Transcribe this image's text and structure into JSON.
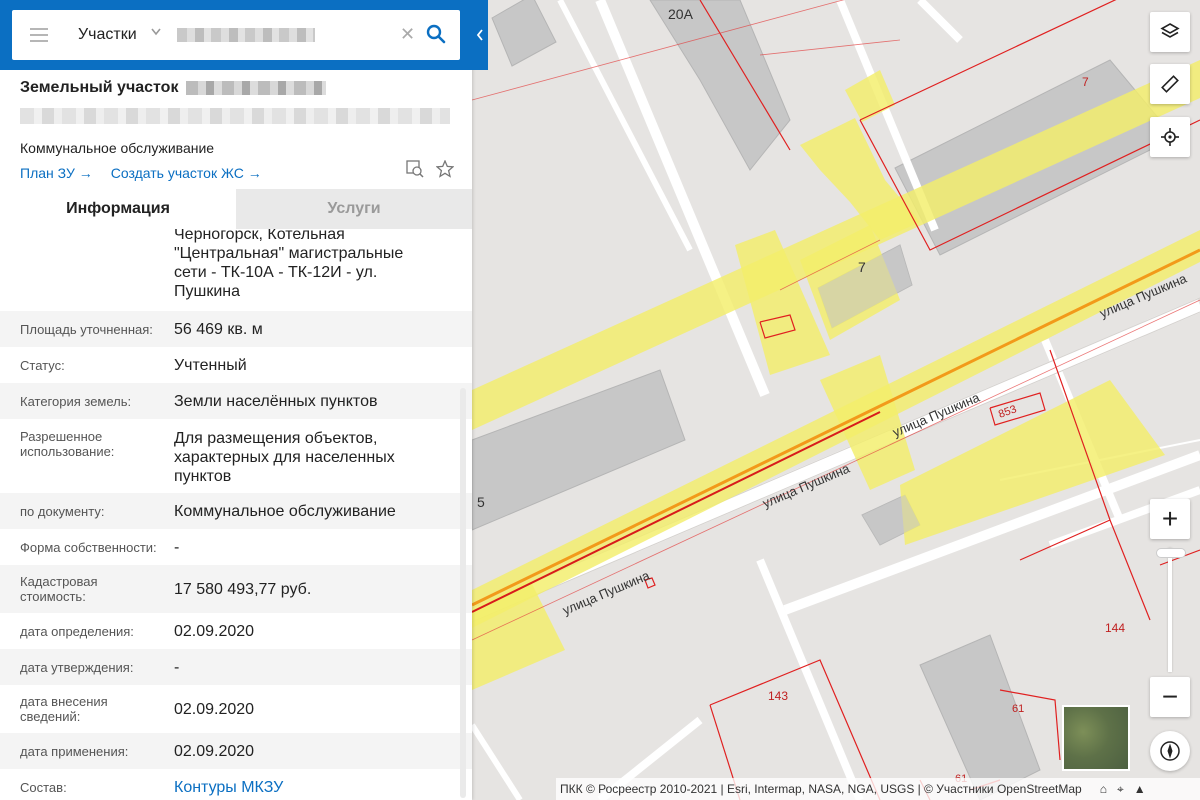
{
  "search": {
    "type_label": "Участки",
    "query_redacted": true
  },
  "object": {
    "title": "Земельный участок",
    "type": "Коммунальное обслуживание",
    "links": [
      "План ЗУ →",
      "Создать участок ЖС →"
    ]
  },
  "tabs": [
    {
      "label": "Информация",
      "active": true
    },
    {
      "label": "Услуги",
      "active": false
    }
  ],
  "info_rows": [
    {
      "label": "",
      "value": "Черногорск, Котельная \"Центральная\" магистральные сети - ТК-10А - ТК-12И - ул. Пушкина"
    },
    {
      "label": "Площадь уточненная:",
      "value": "56 469 кв. м"
    },
    {
      "label": "Статус:",
      "value": "Учтенный"
    },
    {
      "label": "Категория земель:",
      "value": "Земли населённых пунктов"
    },
    {
      "label": "Разрешенное использование:",
      "value": "Для размещения объектов, характерных для населенных пунктов"
    },
    {
      "label": "по документу:",
      "value": "Коммунальное обслуживание"
    },
    {
      "label": "Форма собственности:",
      "value": "-"
    },
    {
      "label": "Кадастровая стоимость:",
      "value": "17 580 493,77 руб."
    },
    {
      "label": "дата определения:",
      "value": "02.09.2020"
    },
    {
      "label": "дата утверждения:",
      "value": "-"
    },
    {
      "label": "дата внесения сведений:",
      "value": "02.09.2020"
    },
    {
      "label": "дата применения:",
      "value": "02.09.2020"
    },
    {
      "label": "Состав:",
      "value": "Контуры МКЗУ"
    }
  ],
  "map": {
    "labels": {
      "street": "улица Пушкина",
      "n20a": "20А",
      "n7a": "7",
      "n7b": "7",
      "n853": "853",
      "n5": "5",
      "n144": "144",
      "n143": "143",
      "n61a": "61",
      "n61b": "61"
    },
    "colors": {
      "highlight": "#f3ee6a",
      "building": "#c9c9c9",
      "parcel_line": "#e02020",
      "road": "#ffffff",
      "background": "#e6e4e2",
      "accent": "#0b6fc2"
    }
  },
  "controls": {
    "zoom_in": "+",
    "zoom_out": "−",
    "icons": [
      "layers-icon",
      "ruler-icon",
      "locate-icon",
      "compass-icon"
    ]
  },
  "attribution": "ПКК © Росреестр 2010-2021 | Esri, Intermap, NASA, NGA, USGS | © Участники OpenStreetMap"
}
